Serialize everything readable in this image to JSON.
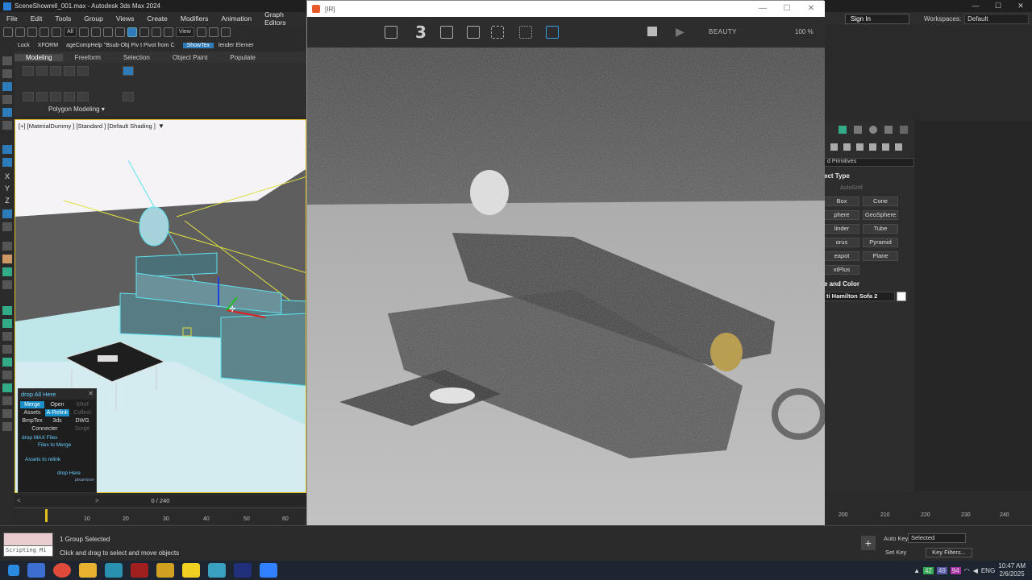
{
  "window": {
    "title": "SceneShowrell_001.max - Autodesk 3ds Max 2024",
    "controls": [
      "—",
      "☐",
      "✕"
    ]
  },
  "menu": [
    "File",
    "Edit",
    "Tools",
    "Group",
    "Views",
    "Create",
    "Modifiers",
    "Animation",
    "Graph Editors"
  ],
  "header_right": {
    "sign_in": "Sign In",
    "workspaces_label": "Workspaces:",
    "workspace": "Default"
  },
  "toolbar": {
    "filter": "All",
    "refcoord": "View"
  },
  "toolbar2": {
    "lock": "Lock",
    "xform": "XFORM",
    "b1": "ageCompHelp",
    "b2": "\"Bsub-Obj Piv",
    "b3": "t Pivot from C",
    "showtex": "ShowTex",
    "b4": "lender Elemer"
  },
  "ribbon": {
    "tabs": [
      "Modeling",
      "Freeform",
      "Selection",
      "Object Paint",
      "Populate"
    ],
    "panel": "Polygon Modeling ▾"
  },
  "viewport": {
    "label": "[+] [MaterialDummy ] [Standard ] [Default Shading ]"
  },
  "drop_panel": {
    "title": "drop All Here",
    "buttons": [
      "Merge",
      "Open",
      "XRef",
      "Assets",
      "A-Relink",
      "Collect",
      "BmpTex",
      "3ds",
      "DWG",
      "Connecter",
      "Script"
    ],
    "drop_max": "drop MAX Files",
    "files_merge": "Files to Merge",
    "assets_relink": "Assets to relink",
    "drop_here": "drop Here",
    "brand": "pixamoon"
  },
  "timeline": {
    "frame": "0 / 240",
    "ticks": [
      "10",
      "20",
      "30",
      "40",
      "50",
      "60"
    ],
    "ticks_right": [
      "200",
      "210",
      "220",
      "230",
      "240"
    ]
  },
  "status": {
    "scripting": "Scripting Mi",
    "selection": "1 Group Selected",
    "prompt": "Click and drag to select and move objects",
    "auto_key": "Auto Key",
    "set_key": "Set Key",
    "key_mode": "Selected",
    "key_filters": "Key Filters..."
  },
  "command_panel": {
    "category": "d Primitives",
    "section_object_type": "ect Type",
    "autogrid": "AutoGrid",
    "objects": [
      "Box",
      "Cone",
      "phere",
      "GeoSphere",
      "linder",
      "Tube",
      "orus",
      "Pyramid",
      "eapot",
      "Plane",
      "xtPlus"
    ],
    "section_name": "e and Color",
    "object_name": "ti Hamilton Sofa 2"
  },
  "frame_buffer": {
    "title": "[IR]",
    "frame_num": "3",
    "channel": "BEAUTY",
    "zoom": "100 %"
  },
  "taskbar": {
    "lang": "ENG",
    "time": "10:47 AM",
    "date": "2/6/2025",
    "tray_nums": [
      "42",
      "49",
      "94"
    ]
  },
  "colors": {
    "accent": "#1a8fc7",
    "viewport_highlight": "#5fe3f0",
    "selection_yellow": "#e0c020"
  }
}
